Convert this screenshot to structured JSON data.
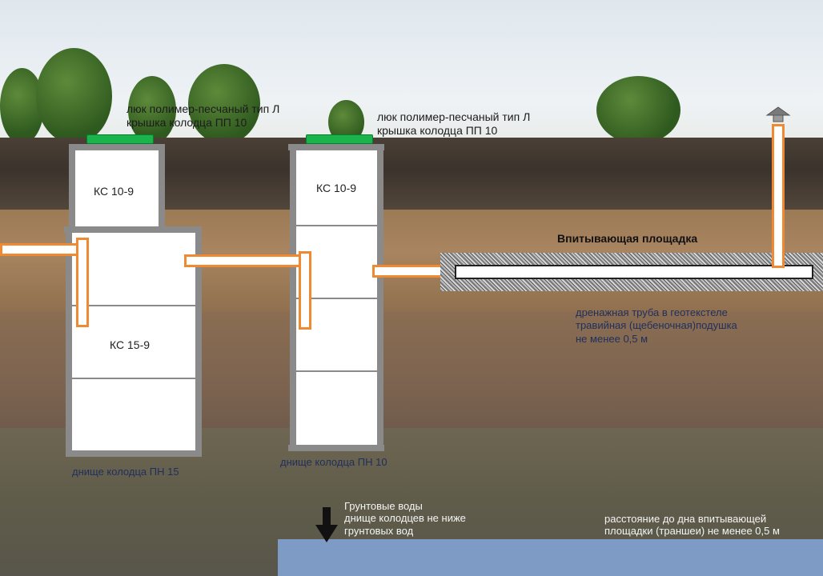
{
  "labels": {
    "hatch1_line1": "люк полимер-песчаный тип Л",
    "hatch1_line2": "крышка колодца ПП 10",
    "hatch2_line1": "люк полимер-песчаный тип Л",
    "hatch2_line2": "крышка колодца ПП 10",
    "well1_top": "КС 10-9",
    "well1_main": "КС 15-9",
    "well2_top": "КС 10-9",
    "well1_bottom": "днище колодца ПН 15",
    "well2_bottom": "днище колодца ПН 10",
    "absorb_area": "Впитывающая площадка",
    "drain_line1": "дренажная труба в геотекстеле",
    "drain_line2": "травийная (щебеночная)подушка",
    "drain_line3": "не менее 0,5 м",
    "groundwater_line1": "Грунтовые воды",
    "groundwater_line2": "днище колодцев не ниже",
    "groundwater_line3": "грунтовых вод",
    "distance_line1": "расстояние до дна впитывающей",
    "distance_line2": "площадки (траншеи) не менее 0,5 м"
  },
  "colors": {
    "pipe": "#f08a32",
    "hatch": "#19b44b",
    "water": "#7d9bc4"
  }
}
